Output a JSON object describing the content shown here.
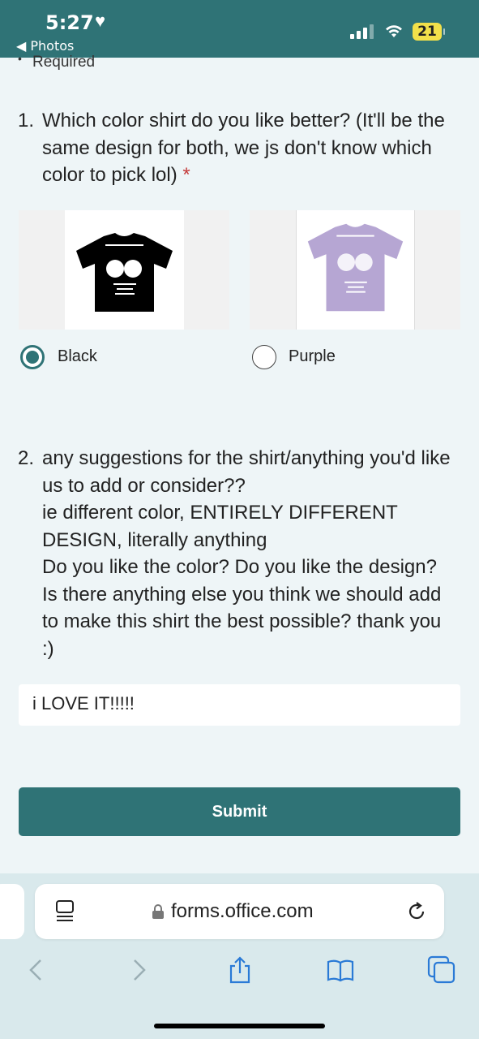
{
  "status_bar": {
    "time": "5:27",
    "back_label": "Photos",
    "battery": "21"
  },
  "form": {
    "required_label": "Required",
    "question1": {
      "number": "1.",
      "text": "Which color shirt do you like better? (It'll be the same design for both, we js don't know which color to pick lol)",
      "required_star": "*",
      "options": [
        {
          "label": "Black",
          "selected": true,
          "shirt_color": "#000000"
        },
        {
          "label": "Purple",
          "selected": false,
          "shirt_color": "#b6a6d3"
        }
      ]
    },
    "question2": {
      "number": "2.",
      "text": "any suggestions for the shirt/anything you'd like us to add or consider??\nie different color, ENTIRELY DIFFERENT DESIGN, literally anything\nDo you like the color? Do you like the design? Is there anything else you think we should add to make this shirt the best possible? thank you :)",
      "answer": "i LOVE IT!!!!!"
    },
    "submit_label": "Submit"
  },
  "browser": {
    "url": "forms.office.com"
  },
  "colors": {
    "accent": "#2f7376",
    "required": "#c43b3b",
    "ios_blue": "#2a7ad6"
  }
}
